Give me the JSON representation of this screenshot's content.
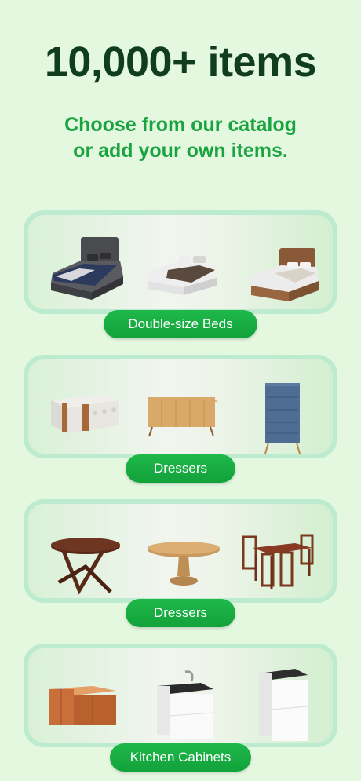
{
  "header": {
    "title": "10,000+ items",
    "subtitle_line1": "Choose from our catalog",
    "subtitle_line2": "or add your own items."
  },
  "categories": [
    {
      "label": "Double-size Beds",
      "items": [
        "bed-gray-upholstered",
        "bed-white-platform",
        "bed-brown-leather"
      ]
    },
    {
      "label": "Dressers",
      "items": [
        "sideboard-white-wood",
        "sideboard-oak",
        "chest-of-drawers-blue"
      ]
    },
    {
      "label": "Dressers",
      "items": [
        "round-dining-table",
        "oval-pedestal-table",
        "dining-set-with-chairs"
      ]
    },
    {
      "label": "Kitchen Cabinets",
      "items": [
        "corner-sink-cabinet",
        "sink-cabinet-white",
        "base-cabinet-white"
      ]
    }
  ],
  "colors": {
    "background": "#e4f7df",
    "title": "#0f3d1d",
    "accent": "#1aa43f",
    "pill": "#16a93f",
    "card_border": "#bdebcf"
  }
}
